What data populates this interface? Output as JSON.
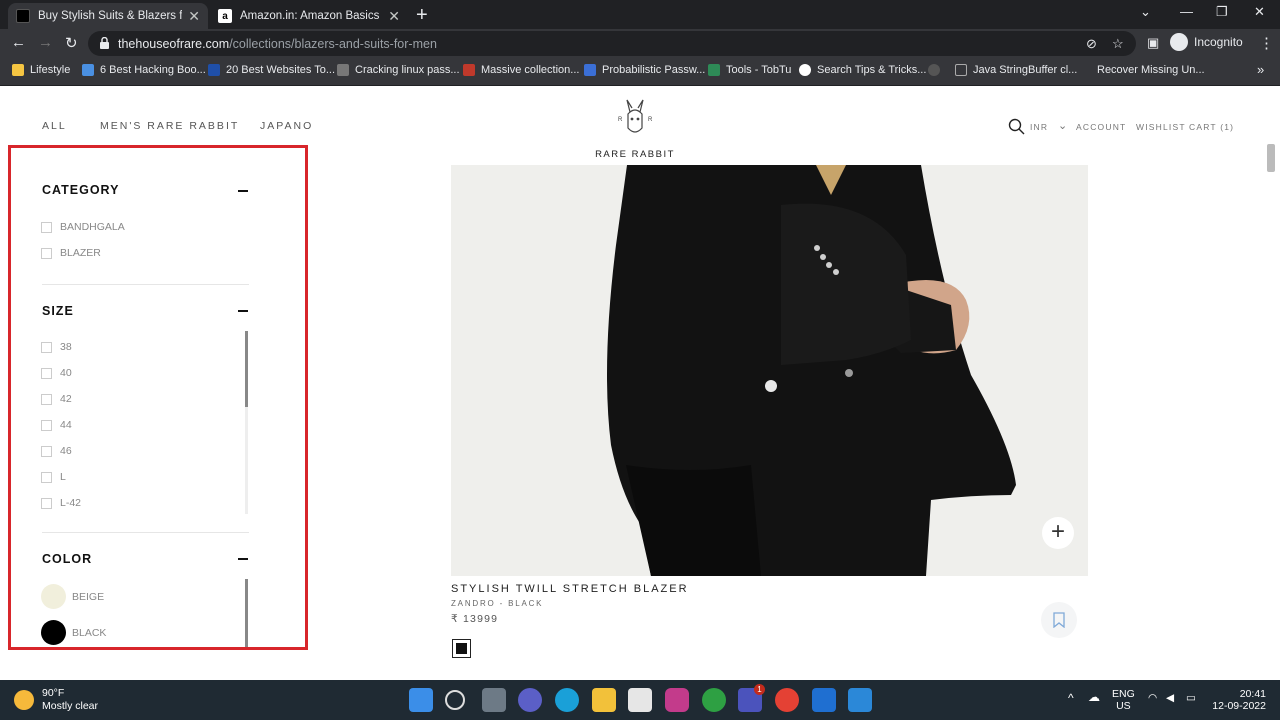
{
  "browser": {
    "tabs": [
      {
        "title": "Buy Stylish Suits & Blazers for Me",
        "active": true
      },
      {
        "title": "Amazon.in: Amazon Basics Smart",
        "active": false
      }
    ],
    "url_domain": "thehouseofrare.com",
    "url_path": "/collections/blazers-and-suits-for-men",
    "profile": "Incognito",
    "bookmarks": [
      "Lifestyle",
      "6 Best Hacking Boo...",
      "20 Best Websites To...",
      "Cracking linux pass...",
      "Massive collection...",
      "Probabilistic Passw...",
      "Tools - TobTu",
      "Search Tips & Tricks...",
      "Java StringBuffer cl...",
      "Recover Missing Un..."
    ],
    "bookmarks_more": "»"
  },
  "site": {
    "nav": [
      "ALL",
      "MEN'S RARE RABBIT",
      "JAPANO"
    ],
    "logo": "RARE RABBIT",
    "logo_mark": [
      "R",
      "R"
    ],
    "currency": "INR",
    "right_nav": [
      "ACCOUNT",
      "WISHLIST",
      "CART (1)"
    ]
  },
  "filters": {
    "category": {
      "title": "CATEGORY",
      "options": [
        "BANDHGALA",
        "BLAZER"
      ]
    },
    "size": {
      "title": "SIZE",
      "options": [
        "38",
        "40",
        "42",
        "44",
        "46",
        "L",
        "L-42"
      ]
    },
    "color": {
      "title": "COLOR",
      "options": [
        {
          "label": "BEIGE",
          "color": "#f1efdc"
        },
        {
          "label": "BLACK",
          "color": "#000000"
        }
      ]
    }
  },
  "product": {
    "title": "STYLISH TWILL STRETCH BLAZER",
    "subtitle": "ZANDRO - BLACK",
    "price": "₹ 13999",
    "swatch_color": "#111111"
  },
  "taskbar": {
    "temp": "90°F",
    "weather": "Mostly clear",
    "lang": "ENG",
    "region": "US",
    "time": "20:41",
    "date": "12-09-2022",
    "teams_badge": "1"
  }
}
